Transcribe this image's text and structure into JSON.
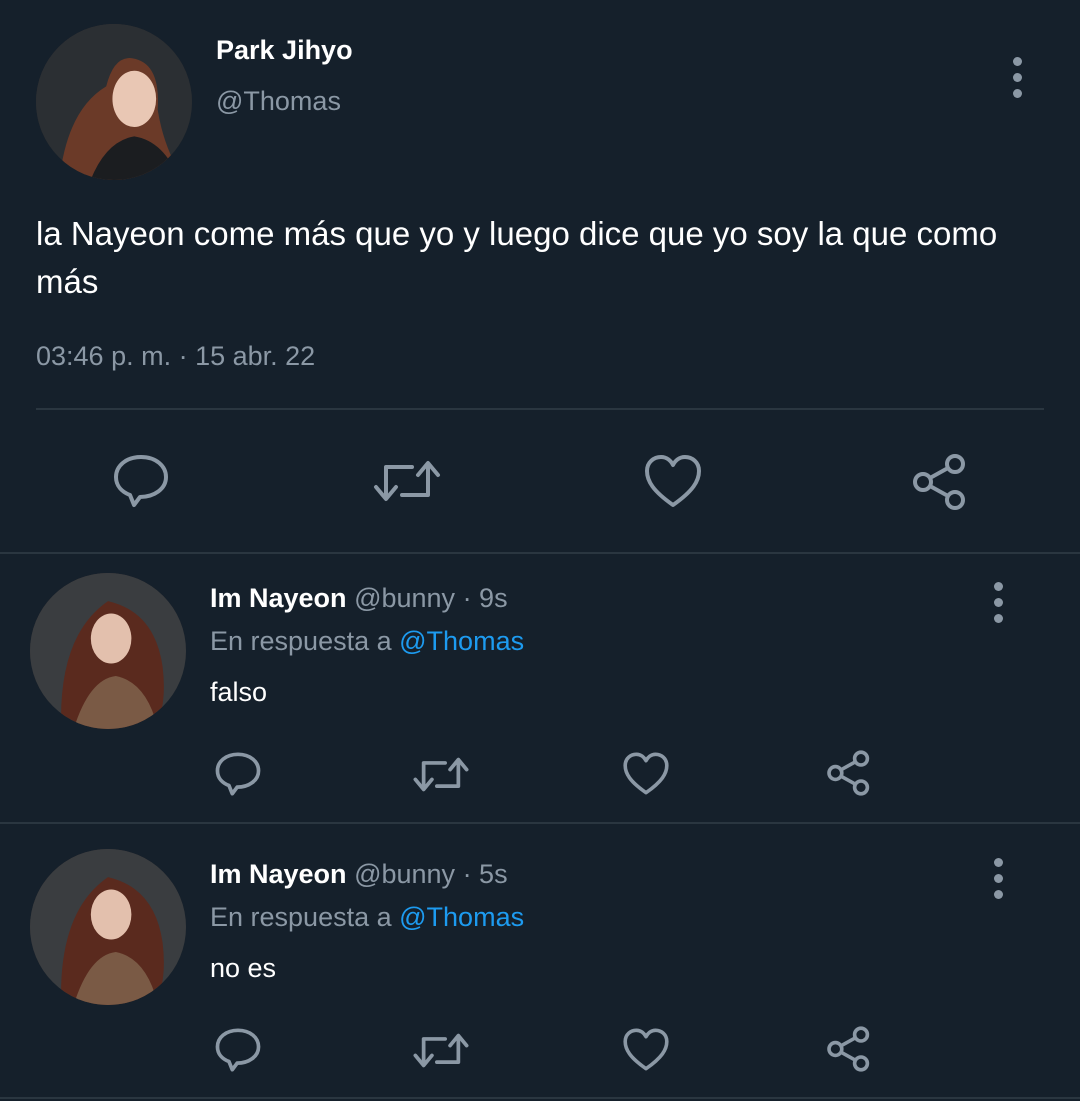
{
  "main_tweet": {
    "display_name": "Park Jihyo",
    "handle": "@Thomas",
    "text": "la Nayeon come más que yo y luego dice que yo soy la que como más",
    "timestamp": "03:46 p. m. · 15 abr. 22"
  },
  "replies": [
    {
      "display_name": "Im Nayeon",
      "handle": "@bunny",
      "age": "· 9s",
      "reply_prefix": "En respuesta a",
      "reply_to": "@Thomas",
      "text": "falso"
    },
    {
      "display_name": "Im Nayeon",
      "handle": "@bunny",
      "age": "· 5s",
      "reply_prefix": "En respuesta a",
      "reply_to": "@Thomas",
      "text": "no es"
    }
  ],
  "icons": {
    "reply": "reply-icon",
    "retweet": "retweet-icon",
    "like": "heart-icon",
    "share": "share-icon",
    "more": "more-vertical-icon"
  },
  "colors": {
    "background": "#15202b",
    "muted": "#8b98a5",
    "link": "#1d9bf0",
    "divider": "#2a3640"
  }
}
